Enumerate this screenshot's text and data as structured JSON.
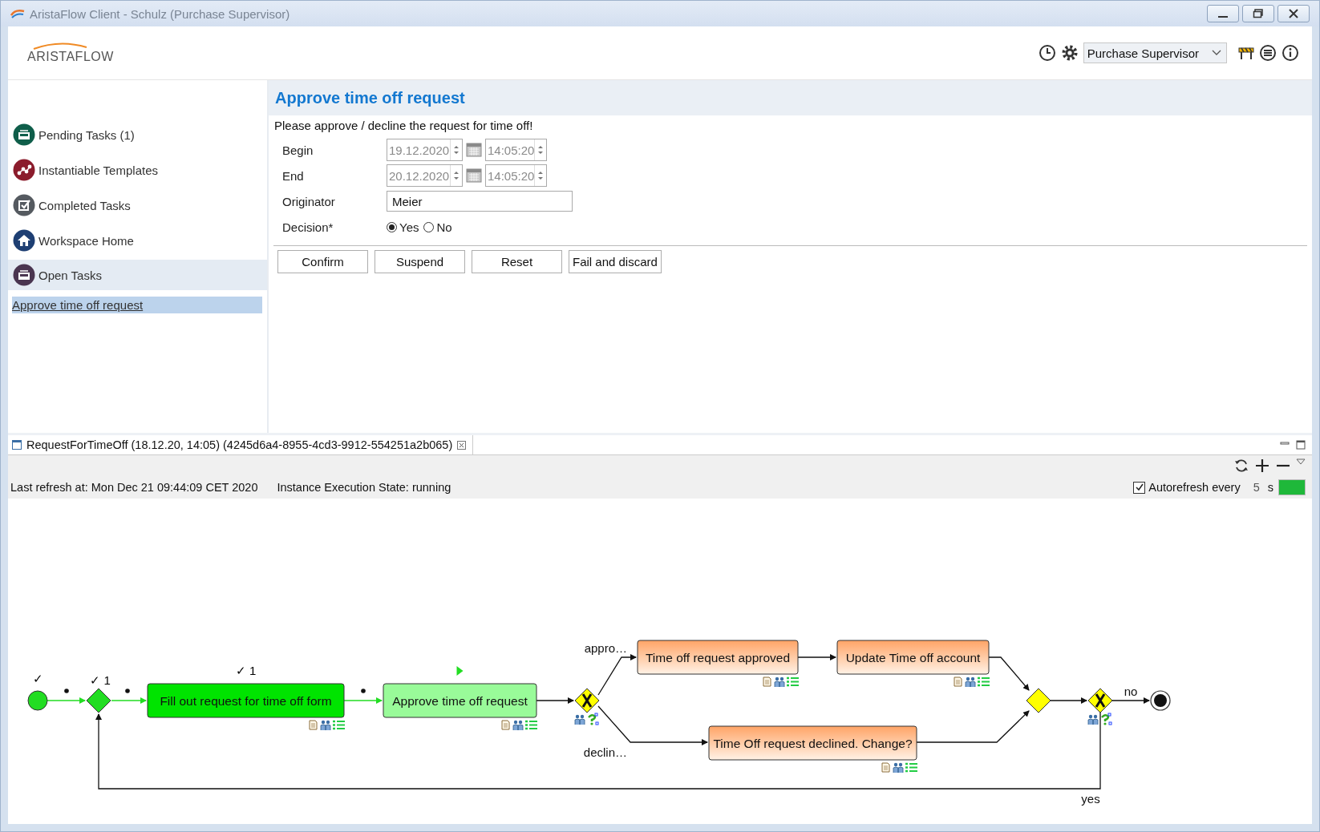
{
  "window": {
    "title": "AristaFlow Client - Schulz (Purchase Supervisor)"
  },
  "header": {
    "logo": "ARISTAFLOW",
    "role": "Purchase Supervisor"
  },
  "sidebar": {
    "items": [
      {
        "label": "Pending Tasks (1)",
        "selected": false
      },
      {
        "label": "Instantiable Templates",
        "selected": false
      },
      {
        "label": "Completed Tasks",
        "selected": false
      },
      {
        "label": "Workspace Home",
        "selected": false
      },
      {
        "label": "Open Tasks",
        "selected": true
      }
    ],
    "open_tasks": [
      {
        "label": "Approve time off request",
        "selected": true
      }
    ]
  },
  "form": {
    "title": "Approve time off request",
    "instruction": "Please approve / decline the request for time off!",
    "fields": [
      {
        "kind": "datetime",
        "label": "Begin",
        "date": "19.12.2020",
        "time": "14:05:20",
        "disabled": true
      },
      {
        "kind": "datetime",
        "label": "End",
        "date": "20.12.2020",
        "time": "14:05:20",
        "disabled": true
      },
      {
        "kind": "text",
        "label": "Originator",
        "value": "Meier"
      },
      {
        "kind": "radio",
        "label": "Decision*",
        "options": [
          {
            "label": "Yes",
            "selected": true
          },
          {
            "label": "No",
            "selected": false
          }
        ]
      }
    ],
    "buttons": [
      "Confirm",
      "Suspend",
      "Reset",
      "Fail and discard"
    ]
  },
  "instance_panel": {
    "tab": "RequestForTimeOff (18.12.20, 14:05) (4245d6a4-8955-4cd3-9912-554251a2b065)",
    "last_refresh": "Last refresh at: Mon Dec 21 09:44:09 CET 2020",
    "execution_state": "Instance Execution State: running",
    "autorefresh": {
      "checked": true,
      "label": "Autorefresh every",
      "value": "5",
      "unit": "s"
    }
  },
  "diagram": {
    "start": {
      "completed": true,
      "mark": "✓"
    },
    "nodes": [
      {
        "kind": "and_gateway",
        "completed": true,
        "activated": false,
        "mark": "✓ 1"
      },
      {
        "kind": "task",
        "label": "Fill out request for time off form",
        "completed": true,
        "activated": false,
        "mark": "✓ 1"
      },
      {
        "kind": "task",
        "label": "Approve time off request",
        "completed": false,
        "activated": true
      },
      {
        "kind": "xor_gateway",
        "completed": false,
        "activated": false
      },
      {
        "kind": "task",
        "label": "Time off request approved",
        "completed": false,
        "activated": false
      },
      {
        "kind": "task",
        "label": "Update Time off account",
        "completed": false,
        "activated": false
      },
      {
        "kind": "task",
        "label": "Time Off request declined. Change?",
        "completed": false,
        "activated": false
      },
      {
        "kind": "and_gateway",
        "completed": false,
        "activated": false
      },
      {
        "kind": "xor_gateway",
        "completed": false,
        "activated": false
      },
      {
        "kind": "end",
        "completed": false,
        "activated": false
      }
    ],
    "edge_labels": [
      "appro…",
      "declin…",
      "no",
      "yes"
    ]
  }
}
